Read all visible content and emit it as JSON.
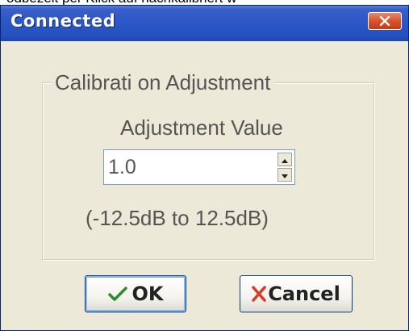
{
  "background_strip": {
    "text": "odbezeit per Klick auf          nachkalibriert w"
  },
  "window": {
    "title": "Connected",
    "close_icon": "close-x-icon",
    "titlebar_color": "#2a56c6",
    "close_color": "#d8542e"
  },
  "group": {
    "legend": "Calibrati on Adjustment",
    "adjustment_label": "Adjustment Value",
    "value": "1.0",
    "range_text": "(-12.5dB to 12.5dB)"
  },
  "buttons": {
    "ok_label": "OK",
    "ok_icon": "checkmark-icon",
    "ok_icon_color": "#2e8b2e",
    "cancel_label": "Cancel",
    "cancel_icon": "red-x-icon",
    "cancel_icon_color": "#d83a2a"
  }
}
